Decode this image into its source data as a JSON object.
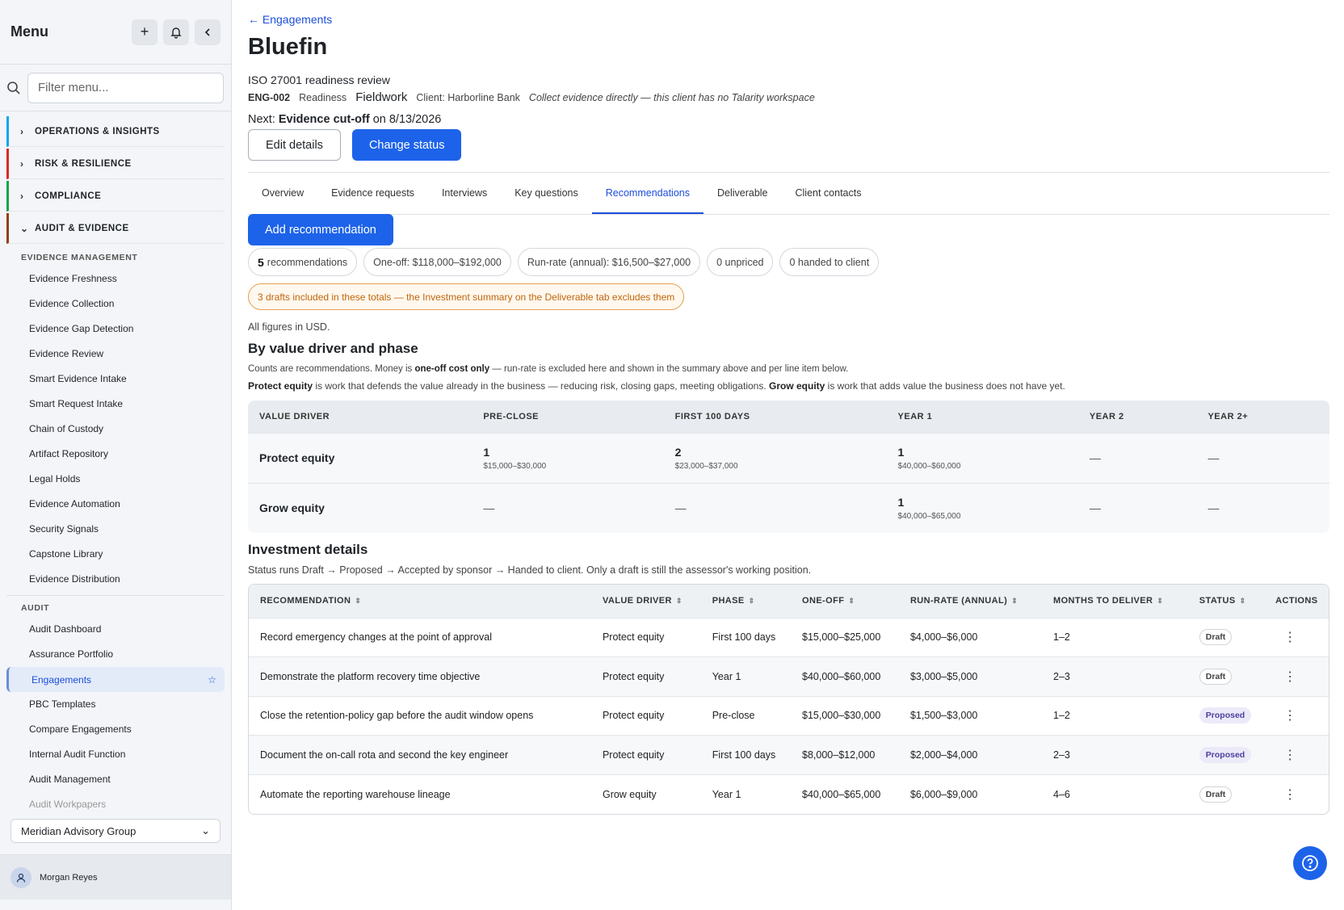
{
  "sidebar": {
    "title": "Menu",
    "filter_placeholder": "Filter menu...",
    "sections": [
      {
        "label": "OPERATIONS & INSIGHTS",
        "color": "#0ea5e9"
      },
      {
        "label": "RISK & RESILIENCE",
        "color": "#dc2626"
      },
      {
        "label": "COMPLIANCE",
        "color": "#16a34a"
      },
      {
        "label": "AUDIT & EVIDENCE",
        "color": "#92400e"
      }
    ],
    "evidence_heading": "EVIDENCE MANAGEMENT",
    "evidence_items": [
      "Evidence Freshness",
      "Evidence Collection",
      "Evidence Gap Detection",
      "Evidence Review",
      "Smart Evidence Intake",
      "Smart Request Intake",
      "Chain of Custody",
      "Artifact Repository",
      "Legal Holds",
      "Evidence Automation",
      "Security Signals",
      "Capstone Library",
      "Evidence Distribution"
    ],
    "audit_heading": "AUDIT",
    "audit_items": [
      "Audit Dashboard",
      "Assurance Portfolio",
      "Engagements",
      "PBC Templates",
      "Compare Engagements",
      "Internal Audit Function",
      "Audit Management",
      "Audit Workpapers"
    ],
    "org": "Meridian Advisory Group",
    "user": "Morgan Reyes"
  },
  "header": {
    "back": "← Engagements",
    "title": "Bluefin",
    "subtitle": "ISO 27001 readiness review",
    "id": "ENG-002",
    "type": "Readiness",
    "phase": "Fieldwork",
    "client": "Client: Harborline Bank",
    "note": "Collect evidence directly — this client has no Talarity workspace",
    "next_prefix": "Next: ",
    "next_bold": "Evidence cut-off",
    "next_suffix": " on 8/13/2026",
    "edit_label": "Edit details",
    "status_label": "Change status"
  },
  "tabs": [
    "Overview",
    "Evidence requests",
    "Interviews",
    "Key questions",
    "Recommendations",
    "Deliverable",
    "Client contacts"
  ],
  "add_rec": "Add recommendation",
  "pills": {
    "count": "5",
    "count_label": "recommendations",
    "oneoff": "One-off: $118,000–$192,000",
    "runrate": "Run-rate (annual): $16,500–$27,000",
    "unpriced": "0 unpriced",
    "handed": "0 handed to client"
  },
  "warning": "3 drafts included in these totals — the Investment summary on the Deliverable tab excludes them",
  "usd_note": "All figures in USD.",
  "vd": {
    "title": "By value driver and phase",
    "desc1a": "Counts are recommendations. Money is ",
    "desc1b": "one-off cost only",
    "desc1c": " — run-rate is excluded here and shown in the summary above and per line item below.",
    "desc2a": "Protect equity",
    "desc2b": " is work that defends the value already in the business — reducing risk, closing gaps, meeting obligations. ",
    "desc2c": "Grow equity",
    "desc2d": " is work that adds value the business does not have yet.",
    "headers": [
      "VALUE DRIVER",
      "PRE-CLOSE",
      "FIRST 100 DAYS",
      "YEAR 1",
      "YEAR 2",
      "YEAR 2+"
    ],
    "rows": [
      {
        "driver": "Protect equity",
        "cells": [
          {
            "c": "1",
            "r": "$15,000–$30,000"
          },
          {
            "c": "2",
            "r": "$23,000–$37,000"
          },
          {
            "c": "1",
            "r": "$40,000–$60,000"
          },
          {
            "c": "—",
            "r": ""
          },
          {
            "c": "—",
            "r": ""
          }
        ]
      },
      {
        "driver": "Grow equity",
        "cells": [
          {
            "c": "—",
            "r": ""
          },
          {
            "c": "—",
            "r": ""
          },
          {
            "c": "1",
            "r": "$40,000–$65,000"
          },
          {
            "c": "—",
            "r": ""
          },
          {
            "c": "—",
            "r": ""
          }
        ]
      }
    ]
  },
  "inv": {
    "title": "Investment details",
    "desc": "Status runs Draft → Proposed → Accepted by sponsor → Handed to client. Only a draft is still the assessor's working position.",
    "headers": [
      "RECOMMENDATION",
      "VALUE DRIVER",
      "PHASE",
      "ONE-OFF",
      "RUN-RATE (ANNUAL)",
      "MONTHS TO DELIVER",
      "STATUS",
      "ACTIONS"
    ],
    "rows": [
      [
        "Record emergency changes at the point of approval",
        "Protect equity",
        "First 100 days",
        "$15,000–$25,000",
        "$4,000–$6,000",
        "1–2",
        "Draft"
      ],
      [
        "Demonstrate the platform recovery time objective",
        "Protect equity",
        "Year 1",
        "$40,000–$60,000",
        "$3,000–$5,000",
        "2–3",
        "Draft"
      ],
      [
        "Close the retention-policy gap before the audit window opens",
        "Protect equity",
        "Pre-close",
        "$15,000–$30,000",
        "$1,500–$3,000",
        "1–2",
        "Proposed"
      ],
      [
        "Document the on-call rota and second the key engineer",
        "Protect equity",
        "First 100 days",
        "$8,000–$12,000",
        "$2,000–$4,000",
        "2–3",
        "Proposed"
      ],
      [
        "Automate the reporting warehouse lineage",
        "Grow equity",
        "Year 1",
        "$40,000–$65,000",
        "$6,000–$9,000",
        "4–6",
        "Draft"
      ]
    ]
  }
}
